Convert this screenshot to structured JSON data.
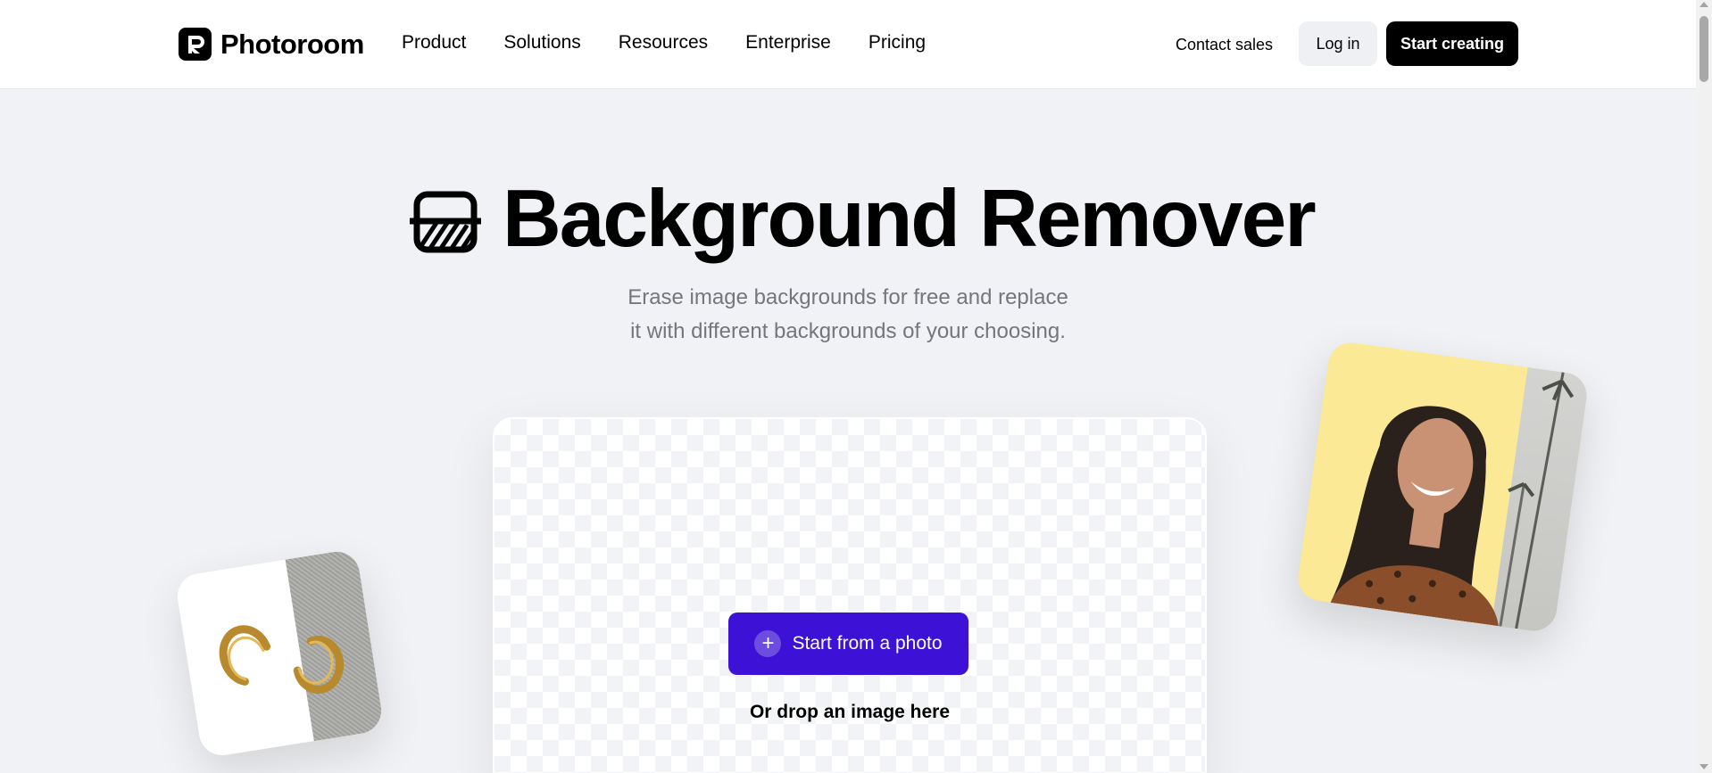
{
  "header": {
    "logo_text": "Photoroom",
    "nav": [
      "Product",
      "Solutions",
      "Resources",
      "Enterprise",
      "Pricing"
    ],
    "contact_sales": "Contact sales",
    "log_in": "Log in",
    "start_creating": "Start creating"
  },
  "hero": {
    "title": "Background Remover",
    "subtitle_line1": "Erase image backgrounds for free and replace",
    "subtitle_line2": "it with different backgrounds of your choosing."
  },
  "upload": {
    "button_label": "Start from a photo",
    "drop_text": "Or drop an image here"
  },
  "colors": {
    "accent": "#3d12d6",
    "page_bg": "#f1f2f5",
    "dark": "#000000"
  }
}
